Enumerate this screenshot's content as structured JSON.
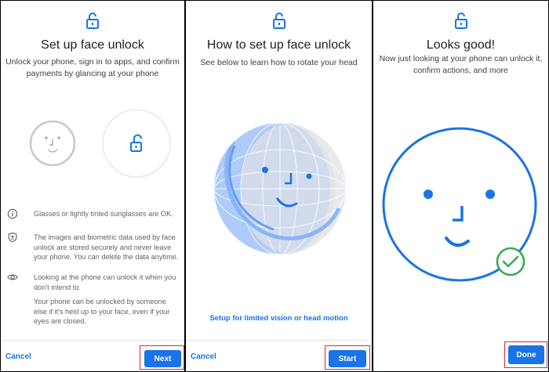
{
  "screen1": {
    "title": "Set up face unlock",
    "subtitle": "Unlock your phone, sign in to apps, and confirm payments by glancing at your phone",
    "info": [
      {
        "icon": "info-icon",
        "text": "Glasses or lightly tinted sunglasses are OK."
      },
      {
        "icon": "shield-icon",
        "text": "The images and biometric data used by face unlock are stored securely and never leave your phone. You can delete the data anytime."
      },
      {
        "icon": "eye-icon",
        "text": "Looking at the phone can unlock it when you don't intend to."
      },
      {
        "icon": "",
        "text": "Your phone can be unlocked by someone else if it's held up to your face, even if your eyes are closed."
      }
    ],
    "cancel_label": "Cancel",
    "next_label": "Next"
  },
  "screen2": {
    "title": "How to set up face unlock",
    "subtitle": "See below to learn how to rotate your head",
    "link_label": "Setup for limited vision or head motion",
    "cancel_label": "Cancel",
    "start_label": "Start"
  },
  "screen3": {
    "title": "Looks good!",
    "subtitle": "Now just looking at your phone can unlock it, confirm actions, and more",
    "done_label": "Done"
  },
  "colors": {
    "accent": "#1a73e8",
    "highlight": "#d62d2d",
    "success": "#34a853",
    "globe": "#aecbfa"
  }
}
